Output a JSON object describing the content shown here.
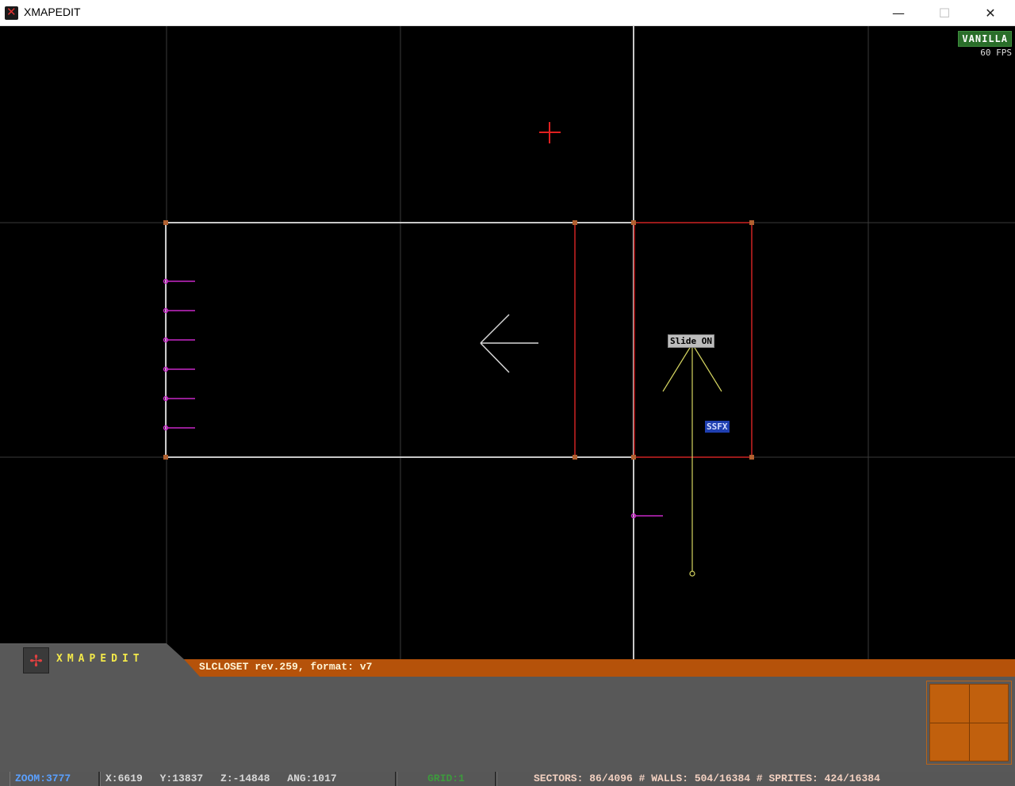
{
  "window": {
    "title": "XMAPEDIT",
    "icon": "xmapedit-app-icon",
    "controls": {
      "minimize": "—",
      "maximize": "☐",
      "close": "✕"
    }
  },
  "map": {
    "mode_badge": "VANILLA",
    "fps": "60 FPS",
    "labels": {
      "slide": "Slide ON",
      "ssfx": "SSFX"
    },
    "colors": {
      "grid": "#3c3c3c",
      "white_walls": "#c8c8c8",
      "red_sector": "#9a1a1a",
      "sprite": "#c828c8",
      "marker": "#d4d460",
      "cursor": "#e02020",
      "vertex": "#b06030"
    }
  },
  "panel": {
    "logo_text": "XMAPEDIT",
    "file_info": "SLCLOSET rev.259, format: v7",
    "accent_color": "#b5520a"
  },
  "status": {
    "zoom": "ZOOM:3777",
    "x": "X:6619",
    "y": "Y:13837",
    "z": "Z:-14848",
    "ang": "ANG:1017",
    "grid": "GRID:1",
    "counts": "SECTORS: 86/4096 # WALLS: 504/16384 # SPRITES: 424/16384"
  }
}
